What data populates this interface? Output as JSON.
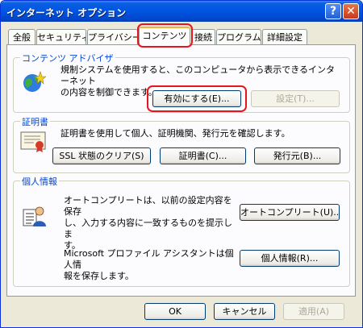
{
  "window": {
    "title": "インターネット オプション",
    "help_icon": "?",
    "close_icon": "✕"
  },
  "tabs": [
    "全般",
    "セキュリティ",
    "プライバシー",
    "コンテンツ",
    "接続",
    "プログラム",
    "詳細設定"
  ],
  "active_tab": "コンテンツ",
  "content_advisor": {
    "legend": "コンテンツ アドバイザ",
    "description": [
      "規制システムを使用すると、このコンピュータから表示できるインターネット",
      "の内容を制御できます。"
    ],
    "enable_button": "有効にする(E)...",
    "settings_button": "設定(T)..."
  },
  "certificates": {
    "legend": "証明書",
    "description": "証明書を使用して個人、証明機関、発行元を確認します。",
    "clear_ssl_button": "SSL 状態のクリア(S)",
    "certificates_button": "証明書(C)...",
    "publishers_button": "発行元(B)..."
  },
  "personal_info": {
    "legend": "個人情報",
    "autocomplete_text": [
      "オートコンプリートは、以前の設定内容を保存",
      "し、入力する内容に一致するものを提示しま",
      "す。"
    ],
    "autocomplete_button": "オートコンプリート(U)...",
    "profile_text": [
      "Microsoft プロファイル アシスタントは個人情",
      "報を保存します。"
    ],
    "profile_button": "個人情報(R)..."
  },
  "footer": {
    "ok": "OK",
    "cancel": "キャンセル",
    "apply": "適用(A)"
  },
  "highlight_color": "#e8141e"
}
